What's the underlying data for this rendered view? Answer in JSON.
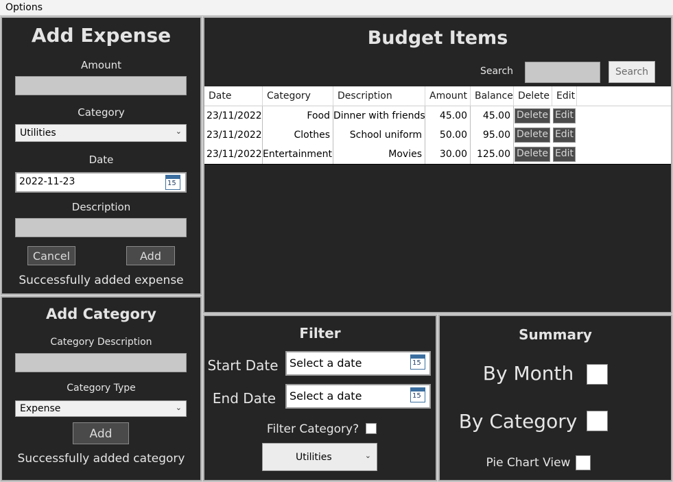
{
  "menu": {
    "options_label": "Options"
  },
  "add_expense": {
    "title": "Add Expense",
    "amount_label": "Amount",
    "amount_value": "",
    "category_label": "Category",
    "category_selected": "Utilities",
    "date_label": "Date",
    "date_value": "2022-11-23",
    "description_label": "Description",
    "description_value": "",
    "cancel_label": "Cancel",
    "add_label": "Add",
    "status": "Successfully added expense"
  },
  "add_category": {
    "title": "Add Category",
    "description_label": "Category Description",
    "description_value": "",
    "type_label": "Category Type",
    "type_selected": "Expense",
    "add_label": "Add",
    "status": "Successfully added category"
  },
  "budget_items": {
    "title": "Budget Items",
    "search_label": "Search",
    "search_value": "",
    "search_button": "Search",
    "columns": [
      "Date",
      "Category",
      "Description",
      "Amount",
      "Balance",
      "Delete",
      "Edit"
    ],
    "rows": [
      {
        "date": "23/11/2022",
        "category": "Food",
        "description": "Dinner with friends",
        "amount": "45.00",
        "balance": "45.00",
        "delete": "Delete",
        "edit": "Edit"
      },
      {
        "date": "23/11/2022",
        "category": "Clothes",
        "description": "School uniform",
        "amount": "50.00",
        "balance": "95.00",
        "delete": "Delete",
        "edit": "Edit"
      },
      {
        "date": "23/11/2022",
        "category": "Entertainment",
        "description": "Movies",
        "amount": "30.00",
        "balance": "125.00",
        "delete": "Delete",
        "edit": "Edit"
      }
    ]
  },
  "filter": {
    "title": "Filter",
    "start_label": "Start Date",
    "start_value": "Select a date",
    "end_label": "End Date",
    "end_value": "Select a date",
    "filter_category_label": "Filter Category?",
    "filter_category_checked": false,
    "category_selected": "Utilities"
  },
  "summary": {
    "title": "Summary",
    "by_month_label": "By Month",
    "by_month_checked": false,
    "by_category_label": "By Category",
    "by_category_checked": false,
    "pie_label": "Pie Chart View",
    "pie_checked": false
  },
  "calendar_icon": {
    "day": "15",
    "accent": "#3c6fa0"
  },
  "colors": {
    "panel_bg": "#252525",
    "panel_border": "#aeaeae",
    "text": "#e6e6e6"
  }
}
